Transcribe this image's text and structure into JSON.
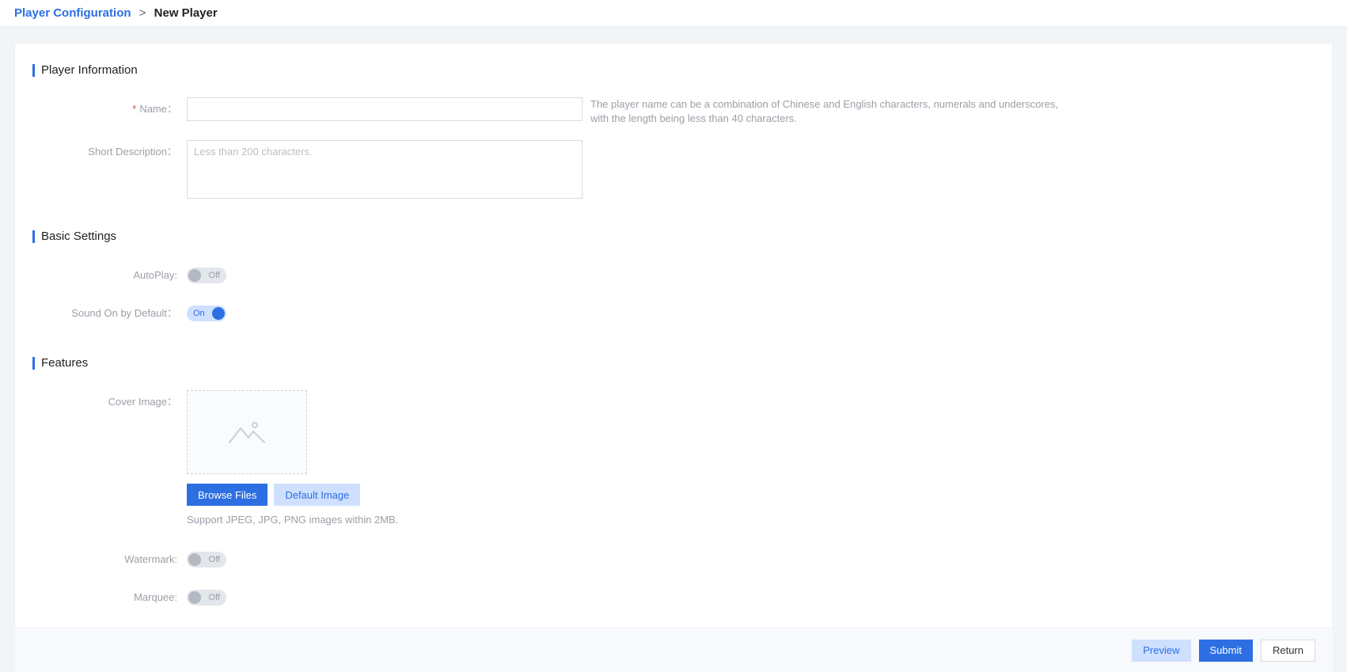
{
  "breadcrumb": {
    "parent": "Player Configuration",
    "separator": ">",
    "current": "New Player"
  },
  "sections": {
    "player_info_title": "Player Information",
    "basic_settings_title": "Basic Settings",
    "features_title": "Features"
  },
  "player_info": {
    "name_label": "Name：",
    "name_value": "",
    "name_hint": "The player name can be a combination of Chinese and English characters, numerals and underscores, with the length being less than 40 characters.",
    "desc_label": "Short Description：",
    "desc_placeholder": "Less than 200 characters.",
    "desc_value": ""
  },
  "basic_settings": {
    "autoplay_label": "AutoPlay:",
    "autoplay_text": "Off",
    "sound_label": "Sound On by Default：",
    "sound_text": "On"
  },
  "features": {
    "cover_label": "Cover Image：",
    "browse_label": "Browse Files",
    "default_label": "Default Image",
    "cover_hint": "Support JPEG, JPG, PNG images within 2MB.",
    "watermark_label": "Watermark:",
    "watermark_text": "Off",
    "marquee_label": "Marquee:",
    "marquee_text": "Off"
  },
  "footer": {
    "preview": "Preview",
    "submit": "Submit",
    "return": "Return"
  }
}
